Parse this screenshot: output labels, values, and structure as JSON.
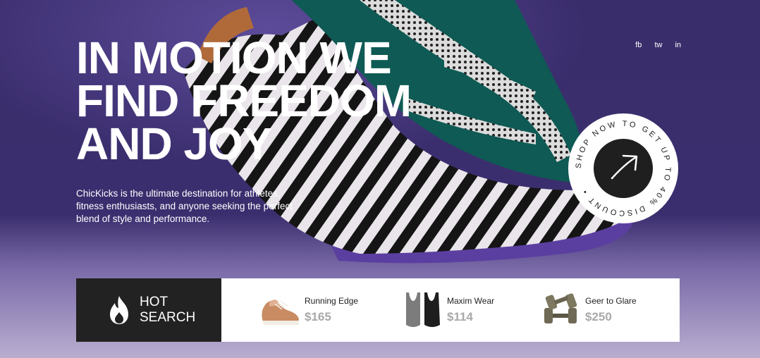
{
  "hero": {
    "headline_lines": [
      "IN MOTION WE",
      "FIND FREEDOM",
      "AND JOY"
    ],
    "description": "ChicKicks is the ultimate destination for athletes, fitness enthusiasts, and anyone seeking the perfect blend of style and performance."
  },
  "social": [
    {
      "label": "fb"
    },
    {
      "label": "tw"
    },
    {
      "label": "in"
    }
  ],
  "badge": {
    "circular_text": "SHOP NOW TO GET UP TO 40% DISCOUNT •"
  },
  "hot_search": {
    "line1": "HOT",
    "line2": "SEARCH"
  },
  "products": [
    {
      "name": "Running Edge",
      "price": "$165",
      "icon": "sneaker-icon"
    },
    {
      "name": "Maxim Wear",
      "price": "$114",
      "icon": "swimsuit-icon"
    },
    {
      "name": "Geer to Glare",
      "price": "$250",
      "icon": "dumbbell-icon"
    }
  ],
  "colors": {
    "background": "#3b2e6e",
    "dark": "#222222",
    "white": "#ffffff",
    "price": "#a9a9a9"
  }
}
